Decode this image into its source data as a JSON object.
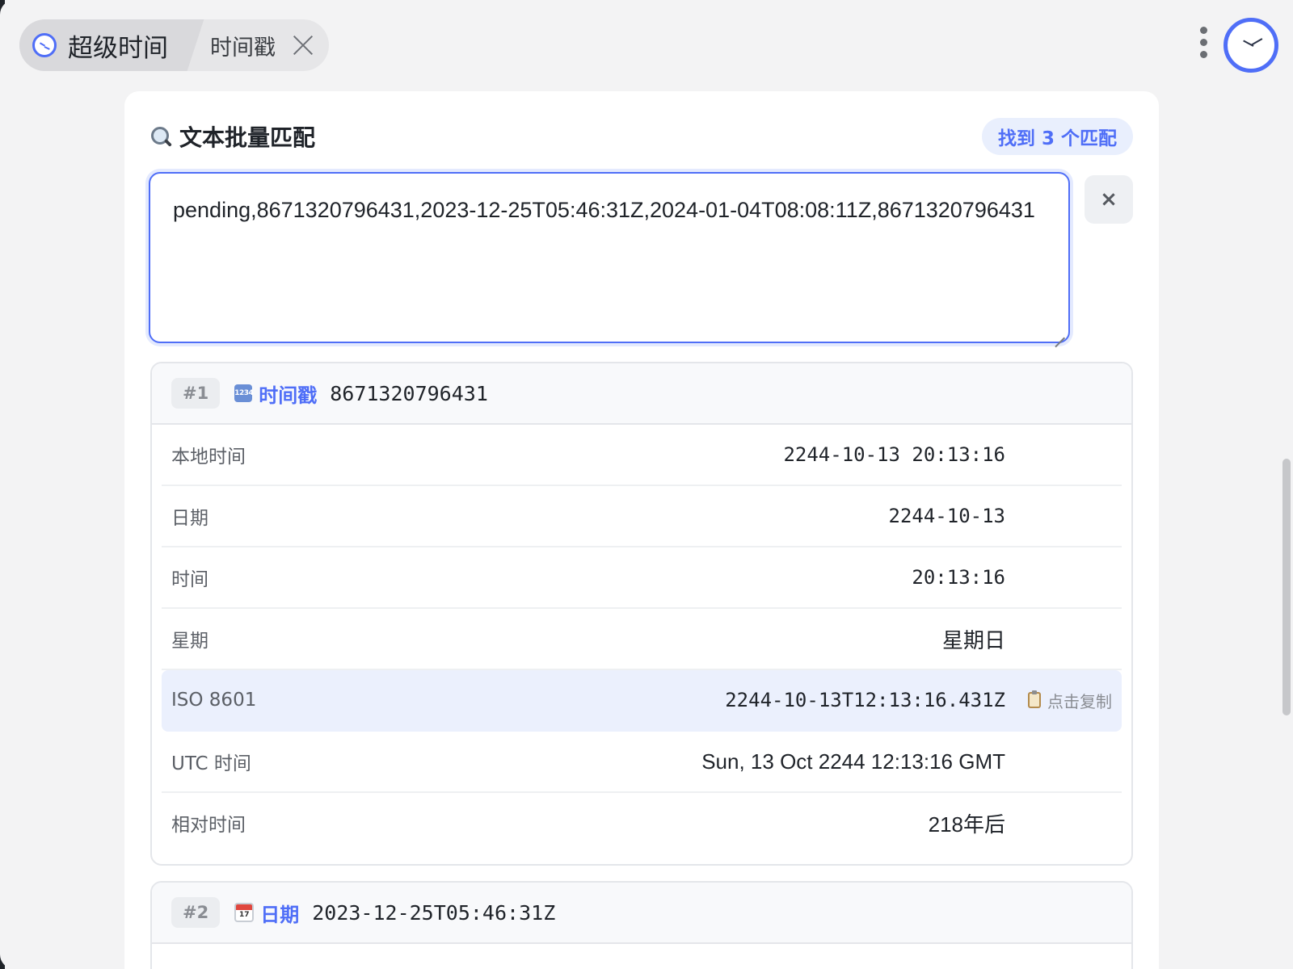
{
  "tabs": {
    "home_label": "超级时间",
    "current_label": "时间戳"
  },
  "icons": {
    "home": "clock-icon",
    "close": "close-icon",
    "more": "more-vertical-icon",
    "app": "clock-icon",
    "search": "magnifier-icon",
    "clear": "close-icon",
    "timestamp_type": "input-numbers-icon",
    "date_type": "calendar-icon",
    "copy": "clipboard-icon"
  },
  "colors": {
    "accent": "#4f6ef7",
    "badge_bg": "#e9effd",
    "highlight_row": "#ebf0fd"
  },
  "panel": {
    "title": "文本批量匹配",
    "match_badge": "找到 3 个匹配",
    "clear_label": "×"
  },
  "input": {
    "value": "pending,8671320796431,2023-12-25T05:46:31Z,2024-01-04T08:08:11Z,8671320796431"
  },
  "results": [
    {
      "index": "#1",
      "type": "时间戳",
      "value": "8671320796431",
      "rows": [
        {
          "label": "本地时间",
          "value": "2244-10-13 20:13:16"
        },
        {
          "label": "日期",
          "value": "2244-10-13"
        },
        {
          "label": "时间",
          "value": "20:13:16"
        },
        {
          "label": "星期",
          "value": "星期日"
        },
        {
          "label": "ISO 8601",
          "value": "2244-10-13T12:13:16.431Z",
          "copy_hint": "点击复制"
        },
        {
          "label": "UTC 时间",
          "value": "Sun, 13 Oct 2244 12:13:16 GMT"
        },
        {
          "label": "相对时间",
          "value": "218年后"
        }
      ]
    },
    {
      "index": "#2",
      "type": "日期",
      "value": "2023-12-25T05:46:31Z"
    }
  ]
}
